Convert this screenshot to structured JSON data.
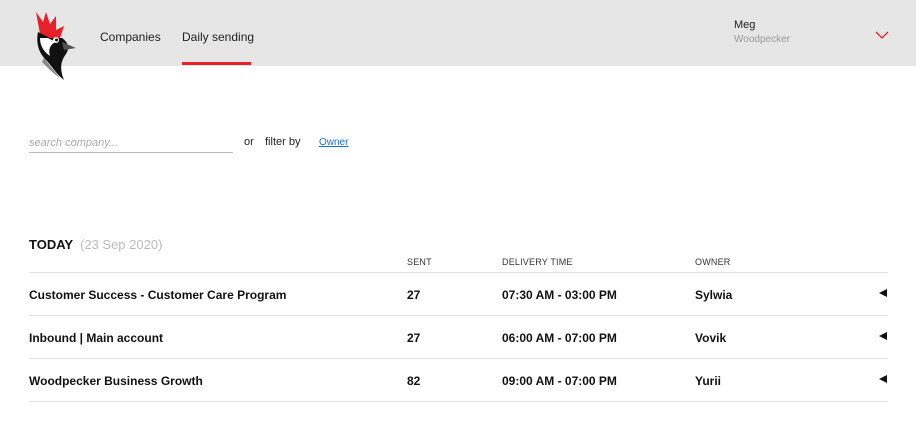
{
  "header": {
    "logo": "woodpecker-logo",
    "tabs": [
      {
        "label": "Companies",
        "active": false
      },
      {
        "label": "Daily sending",
        "active": true
      }
    ],
    "user": {
      "name": "Meg",
      "company": "Woodpecker"
    },
    "accent_color": "#e8202a"
  },
  "filters": {
    "search_placeholder": "search company...",
    "or_label": "or",
    "filter_by_label": "filter by",
    "owner_link": "Owner"
  },
  "today": {
    "title": "TODAY",
    "date": "(23 Sep 2020)"
  },
  "table": {
    "columns": [
      "SENT",
      "DELIVERY TIME",
      "OWNER"
    ],
    "rows": [
      {
        "name": "Customer Success - Customer Care Program",
        "sent": "27",
        "delivery_time": "07:30 AM - 03:00 PM",
        "owner": "Sylwia"
      },
      {
        "name": "Inbound | Main account",
        "sent": "27",
        "delivery_time": "06:00 AM - 07:00 PM",
        "owner": "Vovik"
      },
      {
        "name": "Woodpecker Business Growth",
        "sent": "82",
        "delivery_time": "09:00 AM - 07:00 PM",
        "owner": "Yurii"
      }
    ],
    "row_action_icon": "collapse-arrow-icon"
  }
}
